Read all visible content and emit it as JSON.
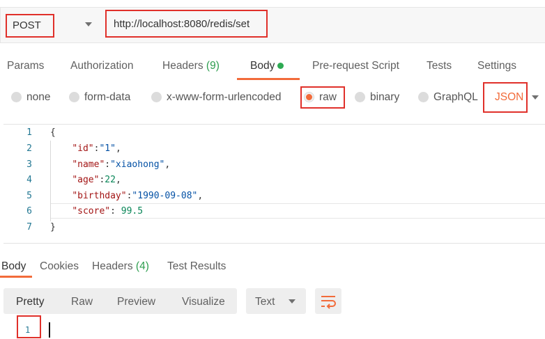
{
  "request": {
    "method": "POST",
    "url": "http://localhost:8080/redis/set"
  },
  "request_tabs": {
    "params": "Params",
    "authorization": "Authorization",
    "headers": "Headers",
    "headers_count": "(9)",
    "body": "Body",
    "pre_request": "Pre-request Script",
    "tests": "Tests",
    "settings": "Settings"
  },
  "body_types": {
    "none": "none",
    "form_data": "form-data",
    "urlencoded": "x-www-form-urlencoded",
    "raw": "raw",
    "binary": "binary",
    "graphql": "GraphQL",
    "selected": "raw",
    "language": "JSON"
  },
  "editor": {
    "line_numbers": [
      "1",
      "2",
      "3",
      "4",
      "5",
      "6",
      "7"
    ],
    "lines": [
      {
        "brace": "{"
      },
      {
        "key": "\"id\"",
        "sep": ":",
        "val": "\"1\"",
        "tail": ","
      },
      {
        "key": "\"name\"",
        "sep": ":",
        "val": "\"xiaohong\"",
        "tail": ","
      },
      {
        "key": "\"age\"",
        "sep": ":",
        "val": "22",
        "tail": ","
      },
      {
        "key": "\"birthday\"",
        "sep": ":",
        "val": "\"1990-09-08\"",
        "tail": ","
      },
      {
        "key": "\"score\"",
        "sep": ": ",
        "val": "99.5",
        "tail": ""
      },
      {
        "brace": "}"
      }
    ]
  },
  "response_tabs": {
    "body": "Body",
    "cookies": "Cookies",
    "headers": "Headers",
    "headers_count": "(4)",
    "test_results": "Test Results"
  },
  "response_toolbar": {
    "pretty": "Pretty",
    "raw": "Raw",
    "preview": "Preview",
    "visualize": "Visualize",
    "format": "Text"
  },
  "response": {
    "line_number": "1"
  },
  "colors": {
    "accent": "#f26b3a",
    "highlight_box": "#e0302a",
    "status_green": "#2eaa53"
  }
}
